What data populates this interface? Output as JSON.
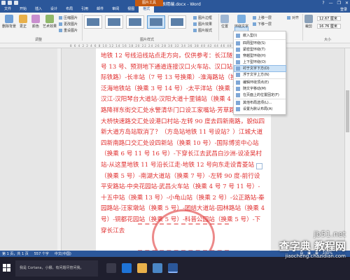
{
  "window": {
    "title": "祖挺报表精编.docx - Word",
    "context_tab": "图片工具",
    "controls": [
      "?",
      "—",
      "❐",
      "✕"
    ]
  },
  "tabs": [
    {
      "label": "文件"
    },
    {
      "label": "开始"
    },
    {
      "label": "插入"
    },
    {
      "label": "设计"
    },
    {
      "label": "布局"
    },
    {
      "label": "引用"
    },
    {
      "label": "邮件"
    },
    {
      "label": "审阅"
    },
    {
      "label": "视图"
    },
    {
      "label": "格式"
    }
  ],
  "login_label": "登录",
  "ribbon": {
    "remove_bg": "删除背景",
    "corrections": "更正",
    "color": "颜色",
    "artistic": "艺术效果",
    "compress": "压缩图片",
    "change_pic": "更改图片",
    "reset_pic": "重设图片",
    "adjust_group": "调整",
    "styles_group": "图片样式",
    "border": "图片边框",
    "effects": "图片效果",
    "layout": "图片版式",
    "position": "位置",
    "wrap_text": "环绕文字",
    "bring_forward": "上移一层",
    "send_backward": "下移一层",
    "align": "对齐",
    "size_group": "大小",
    "height": "12.67 厘米",
    "width": "16.76 厘米",
    "crop": "裁剪"
  },
  "ruler_numbers": "8 6 4 2  2 4 6 8 10 12 14 16 18 20 22 24 26 28 30 32 34 36 38 40 42 44 46 48",
  "document": {
    "text": "地铁 12 号线沿线站点走方向，仅供参考：长江隧道（换乘 2 号 13 号、预测地下通道连接汉口火车站、汉口站广场 汉孝城际铁路）-长丰站（7 号 13 号换乘）-淮海路站（换乘 7 号）-泛海地铁站（换乘 3 号 14 号）-太平洋站（换乘 1 号）-下穿汉江-汉阳琴台大道站-汉阳大道十里铺站（换乘 4 号）-拾芳草路降祥东街交汇处水警清华门口设工家嘴站-芳草路杨鹏路长江大桥快速路交汇处设港口村站-左转 90 度去四新南路，貌似四新大道方岛站取消了？（方岛站地铁 11 号设站？）江城大道四新南路口交汇处设四新站（换乘 10 号）-国际博览中心站（换乘 6 号 11 号 16 号）-下穿长江去武昌白沙洲-设凌吴村站-从这里地铁 11 号沿长江走-地铁 12 号向东走设青菱站（换乘 5 号）-南湖大道站（换乘 7 号）-左转 90 度-前行设平安路站-中央花园站-武昌火车站（换乘 4 号 7 号 11 号）-十五中站（换乘 13 号）-小龟山站（换乘 2 号）-公正路站-秦园路站-汪家墩站（换乘 5 号）-团结大道站-园林路站（换乘 4 号）-铜都花园站（换乘 5 号）-科普公园站（换乘 5 号）-下穿长江去"
  },
  "menu": {
    "items": [
      {
        "label": "嵌入型(I)"
      },
      {
        "label": "四周型环绕(S)"
      },
      {
        "label": "紧密型环绕(T)"
      },
      {
        "label": "穿越型环绕(H)"
      },
      {
        "label": "上下型环绕(O)"
      },
      {
        "label": "衬于文字下方(D)"
      },
      {
        "label": "浮于文字上方(N)"
      },
      {
        "label": "编辑环绕顶点(E)"
      },
      {
        "label": "随文字移动(M)"
      },
      {
        "label": "在页面上的位置固定(F)"
      },
      {
        "label": "其他布局选项(L)..."
      },
      {
        "label": "设置为默认布局(A)"
      }
    ],
    "highlighted_index": 5
  },
  "status": {
    "page": "第 1 页，共 1 页",
    "words": "557 个字",
    "lang": "中文(中国)",
    "zoom": "100%"
  },
  "taskbar": {
    "search_placeholder": "我是 Cortana，小娜。有问题尽管问我。"
  },
  "watermark": {
    "site1": "jb51.net",
    "site2": "查字典 教程网",
    "site3": "jiaocheng.chazidian.com"
  },
  "colors": {
    "word_blue": "#2b579a",
    "doc_text": "#e03030",
    "highlight": "#cde3f7"
  }
}
